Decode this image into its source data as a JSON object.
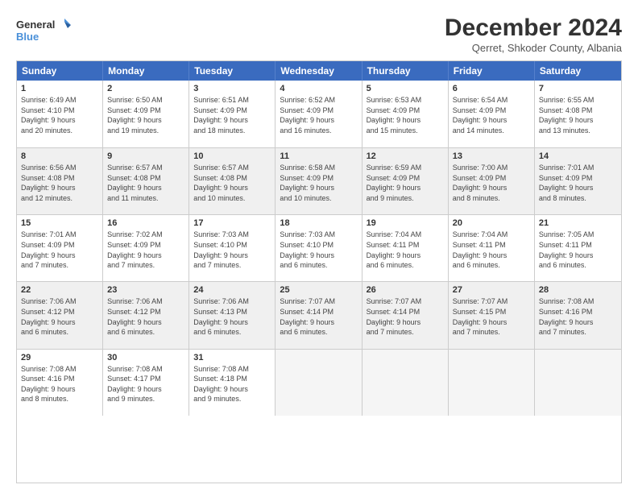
{
  "logo": {
    "line1": "General",
    "line2": "Blue"
  },
  "title": "December 2024",
  "subtitle": "Qerret, Shkoder County, Albania",
  "days": [
    "Sunday",
    "Monday",
    "Tuesday",
    "Wednesday",
    "Thursday",
    "Friday",
    "Saturday"
  ],
  "weeks": [
    [
      {
        "day": "1",
        "info": "Sunrise: 6:49 AM\nSunset: 4:10 PM\nDaylight: 9 hours\nand 20 minutes.",
        "shaded": false
      },
      {
        "day": "2",
        "info": "Sunrise: 6:50 AM\nSunset: 4:09 PM\nDaylight: 9 hours\nand 19 minutes.",
        "shaded": false
      },
      {
        "day": "3",
        "info": "Sunrise: 6:51 AM\nSunset: 4:09 PM\nDaylight: 9 hours\nand 18 minutes.",
        "shaded": false
      },
      {
        "day": "4",
        "info": "Sunrise: 6:52 AM\nSunset: 4:09 PM\nDaylight: 9 hours\nand 16 minutes.",
        "shaded": false
      },
      {
        "day": "5",
        "info": "Sunrise: 6:53 AM\nSunset: 4:09 PM\nDaylight: 9 hours\nand 15 minutes.",
        "shaded": false
      },
      {
        "day": "6",
        "info": "Sunrise: 6:54 AM\nSunset: 4:09 PM\nDaylight: 9 hours\nand 14 minutes.",
        "shaded": false
      },
      {
        "day": "7",
        "info": "Sunrise: 6:55 AM\nSunset: 4:08 PM\nDaylight: 9 hours\nand 13 minutes.",
        "shaded": false
      }
    ],
    [
      {
        "day": "8",
        "info": "Sunrise: 6:56 AM\nSunset: 4:08 PM\nDaylight: 9 hours\nand 12 minutes.",
        "shaded": true
      },
      {
        "day": "9",
        "info": "Sunrise: 6:57 AM\nSunset: 4:08 PM\nDaylight: 9 hours\nand 11 minutes.",
        "shaded": true
      },
      {
        "day": "10",
        "info": "Sunrise: 6:57 AM\nSunset: 4:08 PM\nDaylight: 9 hours\nand 10 minutes.",
        "shaded": true
      },
      {
        "day": "11",
        "info": "Sunrise: 6:58 AM\nSunset: 4:09 PM\nDaylight: 9 hours\nand 10 minutes.",
        "shaded": true
      },
      {
        "day": "12",
        "info": "Sunrise: 6:59 AM\nSunset: 4:09 PM\nDaylight: 9 hours\nand 9 minutes.",
        "shaded": true
      },
      {
        "day": "13",
        "info": "Sunrise: 7:00 AM\nSunset: 4:09 PM\nDaylight: 9 hours\nand 8 minutes.",
        "shaded": true
      },
      {
        "day": "14",
        "info": "Sunrise: 7:01 AM\nSunset: 4:09 PM\nDaylight: 9 hours\nand 8 minutes.",
        "shaded": true
      }
    ],
    [
      {
        "day": "15",
        "info": "Sunrise: 7:01 AM\nSunset: 4:09 PM\nDaylight: 9 hours\nand 7 minutes.",
        "shaded": false
      },
      {
        "day": "16",
        "info": "Sunrise: 7:02 AM\nSunset: 4:09 PM\nDaylight: 9 hours\nand 7 minutes.",
        "shaded": false
      },
      {
        "day": "17",
        "info": "Sunrise: 7:03 AM\nSunset: 4:10 PM\nDaylight: 9 hours\nand 7 minutes.",
        "shaded": false
      },
      {
        "day": "18",
        "info": "Sunrise: 7:03 AM\nSunset: 4:10 PM\nDaylight: 9 hours\nand 6 minutes.",
        "shaded": false
      },
      {
        "day": "19",
        "info": "Sunrise: 7:04 AM\nSunset: 4:11 PM\nDaylight: 9 hours\nand 6 minutes.",
        "shaded": false
      },
      {
        "day": "20",
        "info": "Sunrise: 7:04 AM\nSunset: 4:11 PM\nDaylight: 9 hours\nand 6 minutes.",
        "shaded": false
      },
      {
        "day": "21",
        "info": "Sunrise: 7:05 AM\nSunset: 4:11 PM\nDaylight: 9 hours\nand 6 minutes.",
        "shaded": false
      }
    ],
    [
      {
        "day": "22",
        "info": "Sunrise: 7:06 AM\nSunset: 4:12 PM\nDaylight: 9 hours\nand 6 minutes.",
        "shaded": true
      },
      {
        "day": "23",
        "info": "Sunrise: 7:06 AM\nSunset: 4:12 PM\nDaylight: 9 hours\nand 6 minutes.",
        "shaded": true
      },
      {
        "day": "24",
        "info": "Sunrise: 7:06 AM\nSunset: 4:13 PM\nDaylight: 9 hours\nand 6 minutes.",
        "shaded": true
      },
      {
        "day": "25",
        "info": "Sunrise: 7:07 AM\nSunset: 4:14 PM\nDaylight: 9 hours\nand 6 minutes.",
        "shaded": true
      },
      {
        "day": "26",
        "info": "Sunrise: 7:07 AM\nSunset: 4:14 PM\nDaylight: 9 hours\nand 7 minutes.",
        "shaded": true
      },
      {
        "day": "27",
        "info": "Sunrise: 7:07 AM\nSunset: 4:15 PM\nDaylight: 9 hours\nand 7 minutes.",
        "shaded": true
      },
      {
        "day": "28",
        "info": "Sunrise: 7:08 AM\nSunset: 4:16 PM\nDaylight: 9 hours\nand 7 minutes.",
        "shaded": true
      }
    ],
    [
      {
        "day": "29",
        "info": "Sunrise: 7:08 AM\nSunset: 4:16 PM\nDaylight: 9 hours\nand 8 minutes.",
        "shaded": false
      },
      {
        "day": "30",
        "info": "Sunrise: 7:08 AM\nSunset: 4:17 PM\nDaylight: 9 hours\nand 9 minutes.",
        "shaded": false
      },
      {
        "day": "31",
        "info": "Sunrise: 7:08 AM\nSunset: 4:18 PM\nDaylight: 9 hours\nand 9 minutes.",
        "shaded": false
      },
      {
        "day": "",
        "info": "",
        "shaded": false,
        "empty": true
      },
      {
        "day": "",
        "info": "",
        "shaded": false,
        "empty": true
      },
      {
        "day": "",
        "info": "",
        "shaded": false,
        "empty": true
      },
      {
        "day": "",
        "info": "",
        "shaded": false,
        "empty": true
      }
    ]
  ]
}
